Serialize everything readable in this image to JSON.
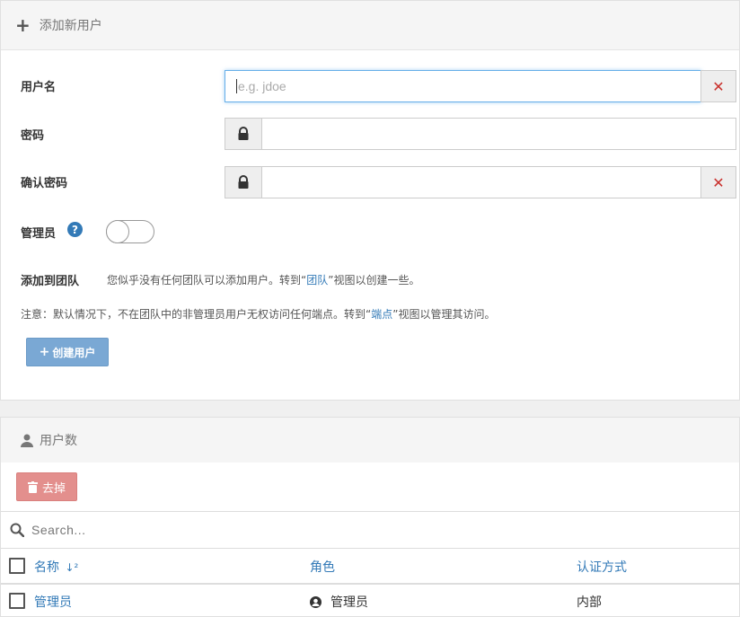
{
  "add_panel": {
    "title": "添加新用户",
    "username_label": "用户名",
    "username_placeholder": "e.g. jdoe",
    "password_label": "密码",
    "confirm_label": "确认密码",
    "admin_label": "管理员",
    "admin_enabled": false,
    "team_label": "添加到团队",
    "team_text_1": "您似乎没有任何团队可以添加用户。转到“",
    "team_link": "团队",
    "team_text_2": "”视图以创建一些。",
    "note_text_1": "注意：默认情况下，不在团队中的非管理员用户无权访问任何端点。转到“",
    "note_link": "端点",
    "note_text_2": "”视图以管理其访问。",
    "create_button": "创建用户"
  },
  "users_panel": {
    "title": "用户数",
    "remove_button": "去掉",
    "search_placeholder": "Search...",
    "columns": {
      "name": "名称",
      "role": "角色",
      "auth": "认证方式"
    },
    "rows": [
      {
        "name": "管理员",
        "role": "管理员",
        "auth": "内部"
      }
    ]
  },
  "colors": {
    "link": "#337ab7",
    "create_button": "#7aa8d4",
    "remove_button": "#e38f8d",
    "clear_x": "#c9302c"
  }
}
